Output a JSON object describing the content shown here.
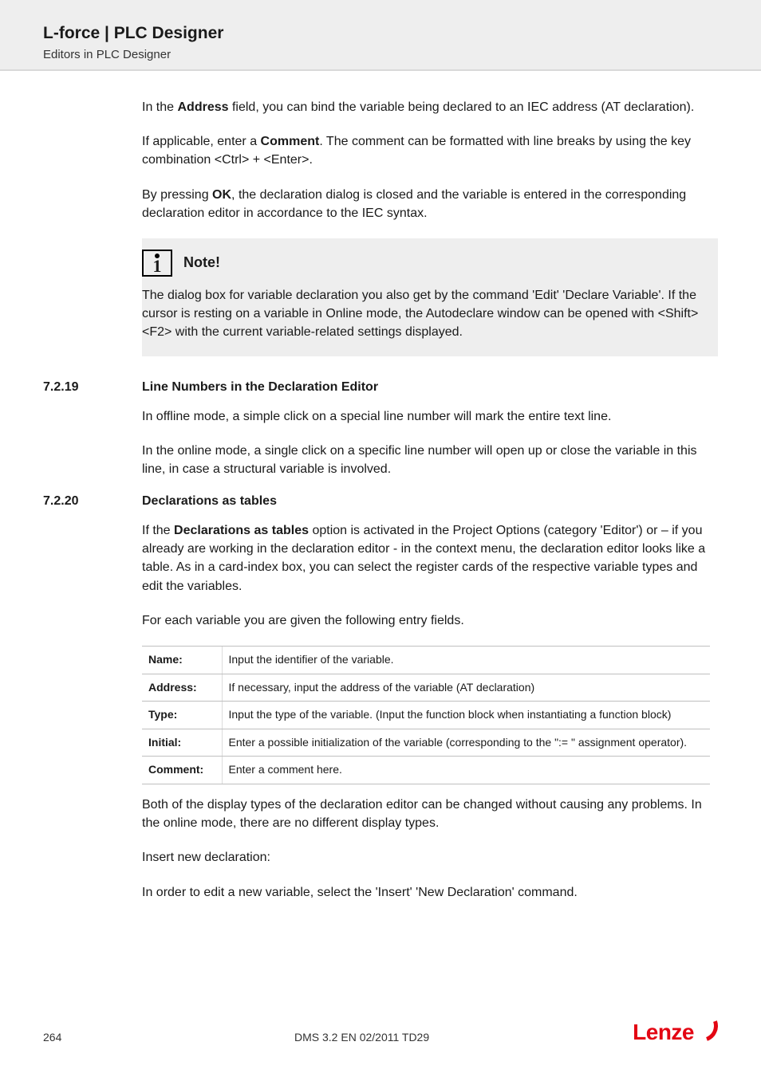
{
  "header": {
    "title": "L-force | PLC Designer",
    "subtitle": "Editors in PLC Designer"
  },
  "intro": {
    "p1_pre": "In the ",
    "p1_bold": "Address",
    "p1_post": " field, you can bind the variable being declared to an IEC address (AT declaration).",
    "p2_pre": "If applicable, enter a ",
    "p2_bold": "Comment",
    "p2_post": ". The comment can be formatted with line breaks by using the key combination <Ctrl> + <Enter>.",
    "p3_pre": "By pressing ",
    "p3_bold": "OK",
    "p3_post": ", the declaration dialog is closed and the variable is entered in the corresponding declaration editor in accordance to the IEC syntax."
  },
  "note": {
    "label": "Note!",
    "body": "The dialog box for variable declaration you also get by the command 'Edit' 'Declare Variable'. If the cursor is resting on a variable in Online mode, the Autodeclare window can be opened with <Shift><F2> with the current variable-related settings displayed."
  },
  "sections": [
    {
      "num": "7.2.19",
      "title": "Line Numbers in the Declaration Editor",
      "paras": [
        "In offline mode, a simple click on a special line number will mark the entire text line.",
        "In the online mode, a single click on a specific line number will open up or close the variable in this line, in case a structural variable is involved."
      ]
    },
    {
      "num": "7.2.20",
      "title": "Declarations as tables",
      "lead_pre": "If the ",
      "lead_bold": "Declarations as tables",
      "lead_post": " option is activated in the Project Options (category 'Editor') or – if you already are working in the declaration editor - in the context menu, the declaration editor looks like a table. As in a card-index box, you can select the register cards of the respective variable types and edit the variables.",
      "paras_after_lead": [
        "For each variable you are given the following entry fields."
      ],
      "table": [
        {
          "k": "Name:",
          "v": "Input the identifier of the variable."
        },
        {
          "k": "Address:",
          "v": "If necessary, input the address of the variable (AT declaration)"
        },
        {
          "k": "Type:",
          "v": "Input the type of the variable. (Input the function block when instantiating a function block)"
        },
        {
          "k": "Initial:",
          "v": "Enter a possible initialization of the variable (corresponding to the \":= \" assignment operator)."
        },
        {
          "k": "Comment:",
          "v": "Enter a comment here."
        }
      ],
      "tail_paras": [
        "Both of the display types of the declaration editor can be changed without causing any problems. In the online mode, there are no different display types.",
        "Insert new declaration:",
        "In order to edit a new variable, select the 'Insert' 'New Declaration' command."
      ]
    }
  ],
  "footer": {
    "page": "264",
    "docid": "DMS 3.2 EN 02/2011 TD29",
    "brand": "Lenze"
  }
}
